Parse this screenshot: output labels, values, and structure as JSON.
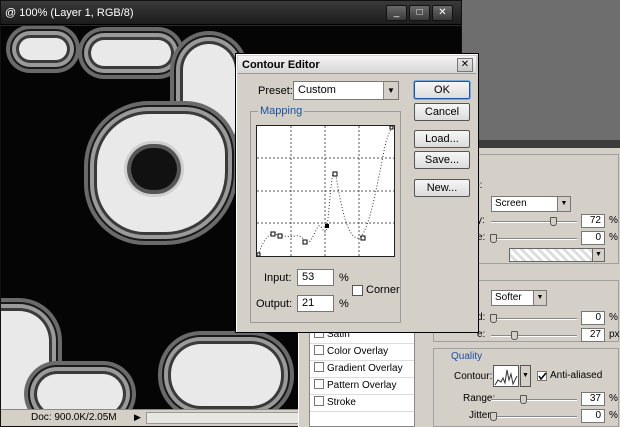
{
  "document": {
    "title": "@ 100% (Layer 1, RGB/8)",
    "status": "Doc: 900.0K/2.05M",
    "minimize": "_",
    "maximize": "□",
    "close": "✕"
  },
  "contour_editor": {
    "title": "Contour Editor",
    "close": "✕",
    "preset_label": "Preset:",
    "preset_value": "Custom",
    "mapping_label": "Mapping",
    "input_label": "Input:",
    "input_value": "53",
    "output_label": "Output:",
    "output_value": "21",
    "percent": "%",
    "corner_label": "Corner",
    "buttons": {
      "ok": "OK",
      "cancel": "Cancel",
      "load": "Load...",
      "save": "Save...",
      "new": "New..."
    }
  },
  "layer_style": {
    "styles": [
      "Satin",
      "Color Overlay",
      "Gradient Overlay",
      "Pattern Overlay",
      "Stroke"
    ],
    "blend_mode_partial": "ode:",
    "blend_mode_value": "Screen",
    "opacity_partial": "y:",
    "opacity_value": "72",
    "noise_partial": "e:",
    "noise_value": "0",
    "technique_value": "Softer",
    "choke_partial": "d:",
    "choke_value": "0",
    "size_partial": "e:",
    "size_value": "27",
    "size_unit": "px",
    "quality_label": "Quality",
    "contour_label": "Contour:",
    "anti_aliased_label": "Anti-aliased",
    "range_label": "Range:",
    "range_value": "37",
    "jitter_label": "Jitter:",
    "jitter_value": "0",
    "percent": "%",
    "opacity_level": 0.72,
    "range_level": 0.37,
    "size_level": 0.27
  }
}
